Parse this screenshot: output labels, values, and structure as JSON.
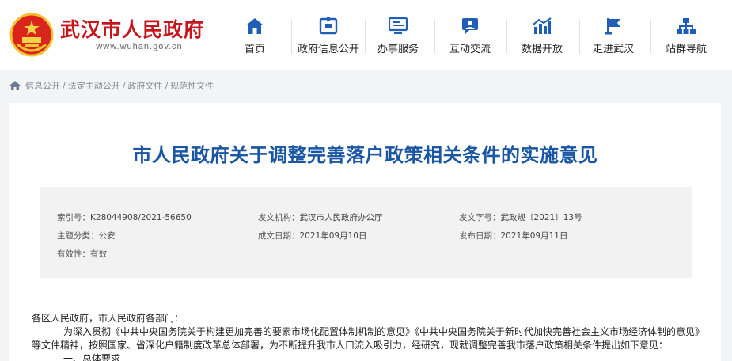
{
  "header": {
    "site_title": "武汉市人民政府",
    "site_url": "www.wuhan.gov.cn",
    "nav": [
      {
        "label": "首页",
        "icon": "home-icon"
      },
      {
        "label": "政府信息公开",
        "icon": "gov-info-icon"
      },
      {
        "label": "办事服务",
        "icon": "service-icon"
      },
      {
        "label": "互动交流",
        "icon": "interaction-icon"
      },
      {
        "label": "数据开放",
        "icon": "data-chart-icon"
      },
      {
        "label": "走进武汉",
        "icon": "flag-icon"
      },
      {
        "label": "站群导航",
        "icon": "sitemap-icon"
      }
    ]
  },
  "breadcrumb": [
    "信息公开",
    "法定主动公开",
    "政府文件",
    "规范性文件"
  ],
  "document": {
    "title": "市人民政府关于调整完善落户政策相关条件的实施意见",
    "meta": {
      "index_label": "索引号：",
      "index_value": "K28044908/2021-56650",
      "issuer_label": "发文机构：",
      "issuer_value": "武汉市人民政府办公厅",
      "doc_no_label": "发文字号：",
      "doc_no_value": "武政规〔2021〕13号",
      "category_label": "主题分类：",
      "category_value": "公安",
      "issue_date_label": "成文日期：",
      "issue_date_value": "2021年09月10日",
      "publish_date_label": "发布日期：",
      "publish_date_value": "2021年09月11日",
      "validity_label": "有效性：",
      "validity_value": "有效"
    },
    "salutation": "各区人民政府，市人民政府各部门：",
    "para1_line1": "为深入贯彻《中共中央国务院关于构建更加完善的要素市场化配置体制机制的意见》《中共中央国务院关于新时代加快完善社会主义市场经济体制的意见》",
    "para1_line2": "等文件精神，按照国家、省深化户籍制度改革总体部署，为不断提升我市人口流入吸引力，经研究，现就调整完善我市落户政策相关条件提出如下意见：",
    "para2": "一、总体要求"
  },
  "colors": {
    "brand_red": "#c4161c",
    "title_blue": "#1a56a4",
    "nav_icon_blue": "#1f5fb5"
  }
}
